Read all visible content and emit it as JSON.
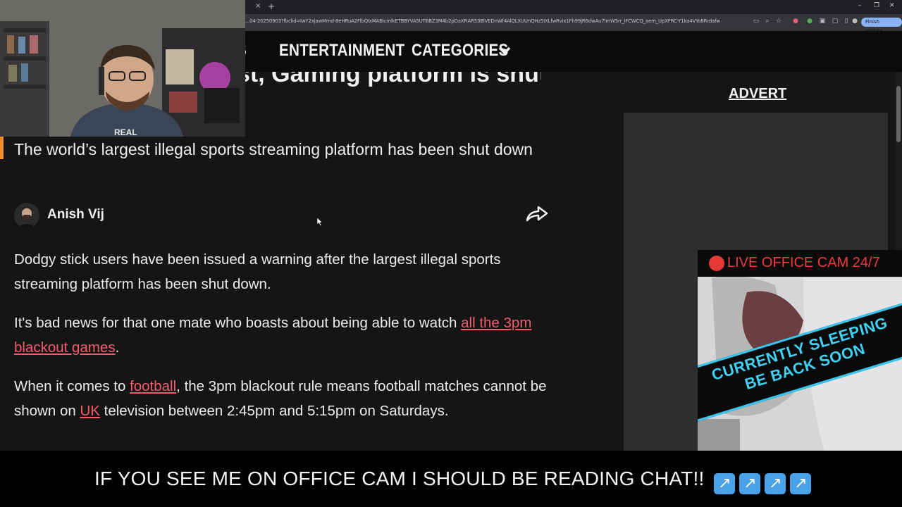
{
  "browser": {
    "url": "...04-20250903?fbclid=IwY2xjawMmd-8eHRuA2FlbQIxMABicmlkETBBYVA5UTBBZ3M4b2pDaXFiAR53BlVEDnWf4AlQLXUUnQHz5IXLfwRvix1Fh99jR6dwAu7lmW5rr_IFCWCQ_aem_UpXFRC-Y1ka4VYo8Rrdafw",
    "tab_close": "×",
    "new_tab": "+",
    "finish_update": "Finish update",
    "window_controls": [
      "–",
      "❐",
      "✕"
    ]
  },
  "site_nav": {
    "partial_item": "S",
    "entertainment": "ENTERTAINMENT",
    "categories": "CATEGORIES"
  },
  "article": {
    "headline_fragment": "st, Gaming platform is shut",
    "standfirst": "The world’s largest illegal sports streaming platform has been shut down",
    "author": "Anish Vij",
    "paragraphs": [
      {
        "text": "Dodgy stick users have been issued a warning after the largest illegal sports streaming platform has been shut down."
      },
      {
        "before": "It's bad news for that one mate who boasts about being able to watch ",
        "link": "all the 3pm blackout games",
        "after": "."
      },
      {
        "before": "When it comes to ",
        "link1": "football",
        "middle": ", the 3pm blackout rule means football matches cannot be shown on ",
        "link2": "UK",
        "after": " television between 2:45pm and 5:15pm on Saturdays."
      }
    ]
  },
  "sidebar": {
    "advert_label": "ADVERT"
  },
  "overlay": {
    "webcam_shirt_text": "REAL",
    "officecam_title": "LIVE OFFICE CAM 24/7",
    "sleep_line1": "CURRENTLY SLEEPING",
    "sleep_line2": "BE BACK SOON",
    "bottom_text": "IF YOU SEE ME ON OFFICE CAM I SHOULD BE READING CHAT!!",
    "bottom_arrow": "↗"
  },
  "colors": {
    "link": "#f25c6b",
    "accent_bar": "#f28a2b",
    "sleep_cyan": "#37c6ee",
    "live_red": "#e53935"
  }
}
